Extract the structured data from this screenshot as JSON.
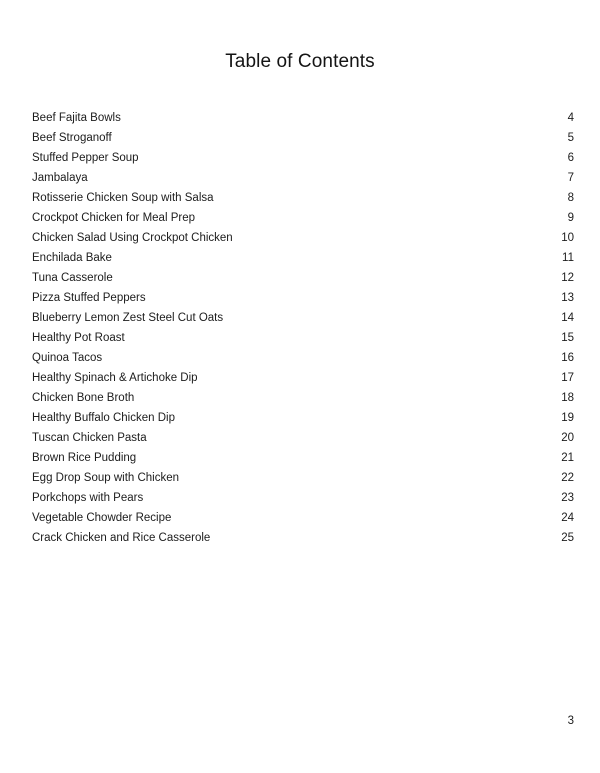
{
  "document": {
    "title": "Table of Contents",
    "footer_page_number": "3",
    "entries": [
      {
        "title": "Beef Fajita Bowls",
        "page": "4"
      },
      {
        "title": "Beef Stroganoff",
        "page": "5"
      },
      {
        "title": "Stuffed Pepper Soup",
        "page": "6"
      },
      {
        "title": "Jambalaya",
        "page": "7"
      },
      {
        "title": "Rotisserie Chicken Soup with Salsa",
        "page": "8"
      },
      {
        "title": "Crockpot Chicken for Meal Prep",
        "page": "9"
      },
      {
        "title": "Chicken Salad Using Crockpot Chicken",
        "page": "10"
      },
      {
        "title": "Enchilada Bake",
        "page": "11"
      },
      {
        "title": "Tuna Casserole",
        "page": "12"
      },
      {
        "title": "Pizza Stuffed Peppers",
        "page": "13"
      },
      {
        "title": "Blueberry Lemon Zest Steel Cut Oats",
        "page": "14"
      },
      {
        "title": "Healthy Pot Roast",
        "page": "15"
      },
      {
        "title": "Quinoa Tacos",
        "page": "16"
      },
      {
        "title": "Healthy Spinach & Artichoke Dip",
        "page": "17"
      },
      {
        "title": "Chicken Bone Broth",
        "page": "18"
      },
      {
        "title": "Healthy Buffalo Chicken Dip",
        "page": "19"
      },
      {
        "title": "Tuscan Chicken Pasta",
        "page": "20"
      },
      {
        "title": "Brown Rice Pudding",
        "page": "21"
      },
      {
        "title": "Egg Drop Soup with Chicken",
        "page": "22"
      },
      {
        "title": "Porkchops with Pears",
        "page": "23"
      },
      {
        "title": "Vegetable Chowder Recipe",
        "page": "24"
      },
      {
        "title": "Crack Chicken and Rice Casserole",
        "page": "25"
      }
    ]
  }
}
